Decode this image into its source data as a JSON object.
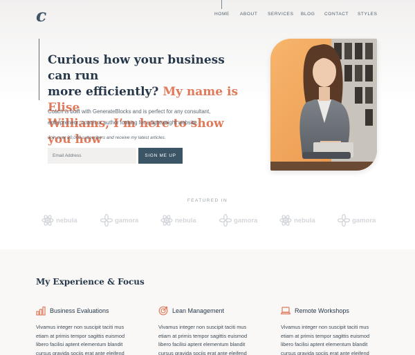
{
  "header": {
    "logo": "c",
    "nav": [
      "HOME",
      "ABOUT",
      "SERVICES",
      "BLOG",
      "CONTACT",
      "STYLES"
    ]
  },
  "hero": {
    "heading_plain": "Curious how your business can run more efficiently?",
    "heading_line1": "Curious how your business can run",
    "heading_line2a": "more efficiently?",
    "heading_line2b": "My name is Elise",
    "heading_line3": "Williams, I’m here to show you how",
    "description": "Coach is built with GenerateBlocks and is perfect for any consultant, entrepreneur, coach or author looking for a lightweight website.",
    "subscribers_note": "Join over 20,000 subscribers and receive my latest articles.",
    "email_placeholder": "Email Address",
    "signup_label": "SIGN ME UP"
  },
  "featured": {
    "label": "FEATURED IN",
    "logos": [
      {
        "name": "nebula",
        "icon": "atom-icon"
      },
      {
        "name": "gamora",
        "icon": "flower-icon"
      },
      {
        "name": "nebula",
        "icon": "atom-icon"
      },
      {
        "name": "gamora",
        "icon": "flower-icon"
      },
      {
        "name": "nebula",
        "icon": "atom-icon"
      },
      {
        "name": "gamora",
        "icon": "flower-icon"
      }
    ]
  },
  "experience": {
    "title": "My Experience & Focus",
    "columns": [
      {
        "title": "Business Evaluations",
        "icon": "bar-chart-icon",
        "text": "Vivamus integer non suscipit taciti mus etiam at primis tempor sagittis euismod libero facilisi aptent elementum blandit cursus gravida sociis erat ante eleifend"
      },
      {
        "title": "Lean Management",
        "icon": "target-icon",
        "text": "Vivamus integer non suscipit taciti mus etiam at primis tempor sagittis euismod libero facilisi aptent elementum blandit cursus gravida sociis erat ante eleifend"
      },
      {
        "title": "Remote Workshops",
        "icon": "laptop-icon",
        "text": "Vivamus integer non suscipit taciti mus etiam at primis tempor sagittis euismod libero facilisi aptent elementum blandit cursus gravida sociis erat ante eleifend"
      }
    ]
  },
  "colors": {
    "accent": "#e07a5b",
    "primary": "#3b5566",
    "heading": "#27384a"
  }
}
